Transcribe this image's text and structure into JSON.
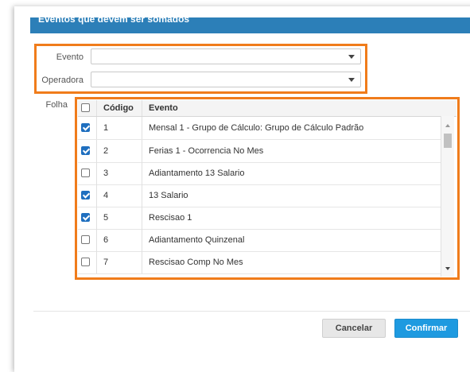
{
  "dialog": {
    "section_title": "Eventos que devem ser somados"
  },
  "form": {
    "evento_label": "Evento",
    "evento_value": "",
    "operadora_label": "Operadora",
    "operadora_value": "",
    "folha_label": "Folha"
  },
  "grid": {
    "columns": [
      "",
      "Código",
      "Evento"
    ],
    "rows": [
      {
        "checked": true,
        "code": "1",
        "event": "Mensal 1 - Grupo de Cálculo: Grupo de Cálculo Padrão"
      },
      {
        "checked": true,
        "code": "2",
        "event": "Ferias 1 - Ocorrencia No Mes"
      },
      {
        "checked": false,
        "code": "3",
        "event": "Adiantamento 13 Salario"
      },
      {
        "checked": true,
        "code": "4",
        "event": "13 Salario"
      },
      {
        "checked": true,
        "code": "5",
        "event": "Rescisao 1"
      },
      {
        "checked": false,
        "code": "6",
        "event": "Adiantamento Quinzenal"
      },
      {
        "checked": false,
        "code": "7",
        "event": "Rescisao Comp No Mes"
      }
    ]
  },
  "buttons": {
    "cancel": "Cancelar",
    "confirm": "Confirmar"
  },
  "colors": {
    "header": "#2c7fb8",
    "highlight": "#f07c1b",
    "confirm": "#1e9ae0",
    "checkbox": "#1f6fbf"
  }
}
